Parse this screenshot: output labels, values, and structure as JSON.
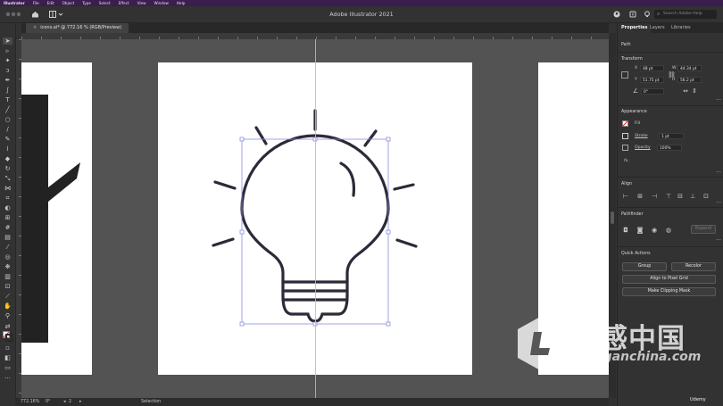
{
  "mac_menu": [
    "Illustrator",
    "File",
    "Edit",
    "Object",
    "Type",
    "Select",
    "Effect",
    "View",
    "Window",
    "Help"
  ],
  "app_title": "Adobe Illustrator 2021",
  "search": {
    "placeholder": "Search Adobe Help"
  },
  "document_tab": {
    "close": "×",
    "label": "icons.ai* @ 772.16 % (RGB/Preview)"
  },
  "status_bar": {
    "zoom": "772.16%",
    "rotation": "0°",
    "artboard": "2",
    "tool": "Selection"
  },
  "panel": {
    "tabs": [
      "Properties",
      "Layers",
      "Libraries"
    ],
    "selection_type": "Path",
    "transform": {
      "title": "Transform",
      "x_label": "X",
      "x_value": "48 pt",
      "y_label": "Y",
      "y_value": "51.75 pt",
      "w_label": "W",
      "w_value": "44.34 pt",
      "h_label": "H",
      "h_value": "56.2 pt",
      "angle_value": "0°"
    },
    "appearance": {
      "title": "Appearance",
      "fill_label": "Fill",
      "stroke_label": "Stroke",
      "stroke_value": "1 pt",
      "opacity_label": "Opacity",
      "opacity_value": "100%",
      "fx_label": "fx."
    },
    "align": {
      "title": "Align"
    },
    "pathfinder": {
      "title": "Pathfinder",
      "expand_label": "Expand"
    },
    "quick_actions": {
      "title": "Quick Actions",
      "group_label": "Group",
      "recolor_label": "Recolor",
      "align_pixel_label": "Align to Pixel Grid",
      "clipping_mask_label": "Make Clipping Mask"
    }
  },
  "watermark": {
    "chinese": "灵感中国",
    "url": "lingganchina.com",
    "brand": "Udemy"
  },
  "colors": {
    "accent_blue": "#7fd3e6",
    "selection": "#8a8ee0",
    "icon_stroke": "#2c2a38",
    "mac_menu_bg": "#3a1e4e"
  }
}
